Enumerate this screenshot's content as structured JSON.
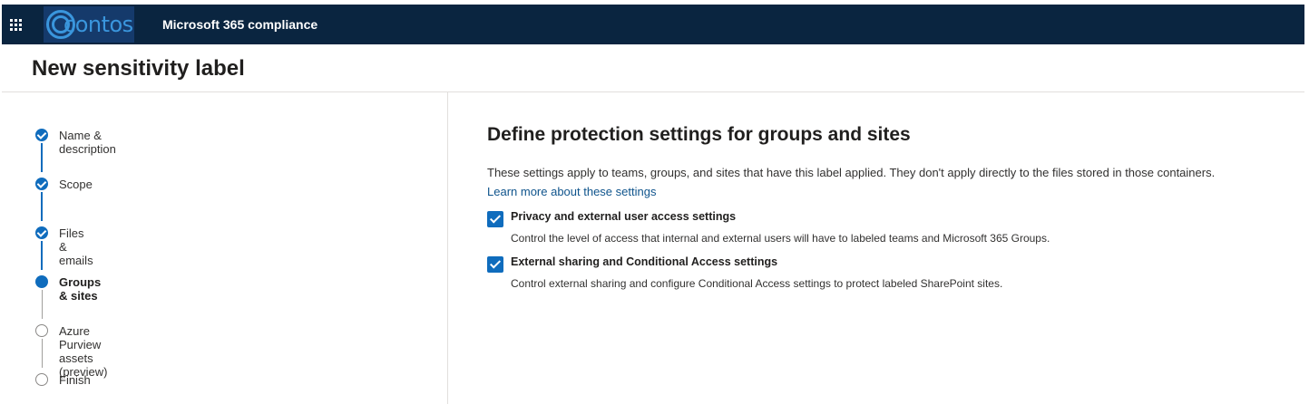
{
  "header": {
    "logo_text": "contoso",
    "app_title": "Microsoft 365 compliance"
  },
  "page": {
    "title": "New sensitivity label"
  },
  "wizard": {
    "steps": [
      {
        "label": "Name & description",
        "state": "completed"
      },
      {
        "label": "Scope",
        "state": "completed"
      },
      {
        "label": "Files & emails",
        "state": "completed"
      },
      {
        "label": "Groups & sites",
        "state": "current"
      },
      {
        "label": "Azure Purview assets (preview)",
        "state": "not-started"
      },
      {
        "label": "Finish",
        "state": "not-started"
      }
    ]
  },
  "main": {
    "heading": "Define protection settings for groups and sites",
    "description": "These settings apply to teams, groups, and sites that have this label applied. They don't apply directly to the files stored in those containers.",
    "learn_more": "Learn more about these settings",
    "options": [
      {
        "title": "Privacy and external user access settings",
        "description": "Control the level of access that internal and external users will have to labeled teams and Microsoft 365 Groups.",
        "checked": true
      },
      {
        "title": "External sharing and Conditional Access settings",
        "description": "Control external sharing and configure Conditional Access settings to protect labeled SharePoint sites.",
        "checked": true
      }
    ]
  },
  "colors": {
    "topbar": "#0a2540",
    "accent": "#0f6cbd",
    "link": "#0f548c"
  }
}
